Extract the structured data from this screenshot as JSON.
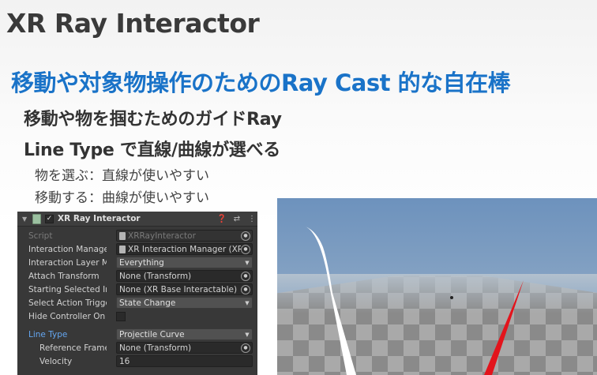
{
  "slide": {
    "title": "XR Ray Interactor",
    "heading": "移動や対象物操作のためのRay Cast 的な自在棒",
    "bullets": [
      "移動や物を掴むためのガイドRay",
      "Line Type で直線/曲線が選べる"
    ],
    "sub_bullets": [
      "物を選ぶ：直線が使いやすい",
      "移動する：曲線が使いやすい"
    ]
  },
  "inspector": {
    "title": "XR Ray Interactor",
    "enabled_mark": "✓",
    "icons": [
      "question-icon",
      "preset-icon",
      "more-icon"
    ],
    "rows": {
      "script": {
        "label": "Script",
        "value": "XRRayInteractor"
      },
      "interaction_manager": {
        "label": "Interaction Manager",
        "value": "XR Interaction Manager (XRInte"
      },
      "interaction_layer_mask": {
        "label": "Interaction Layer Mask",
        "value": "Everything"
      },
      "attach_transform": {
        "label": "Attach Transform",
        "value": "None (Transform)"
      },
      "starting_selected": {
        "label": "Starting Selected Intera",
        "value": "None (XR Base Interactable)"
      },
      "select_action_trigger": {
        "label": "Select Action Trigger",
        "value": "State Change"
      },
      "hide_controller": {
        "label": "Hide Controller On Sele",
        "value": false
      },
      "line_type": {
        "label": "Line Type",
        "value": "Projectile Curve"
      },
      "reference_frame": {
        "label": "Reference Frame",
        "value": "None (Transform)"
      },
      "velocity": {
        "label": "Velocity",
        "value": "16"
      }
    }
  },
  "scene": {
    "sky_top": "#6d92bd",
    "sky_bottom": "#9fb4c9",
    "floor_light": "#a9a9a9",
    "floor_dark": "#8a8a8a",
    "ray_white": "#ffffff",
    "ray_red": "#e3141c"
  },
  "colors": {
    "heading_blue": "#1a73c8",
    "title_gray": "#3a3a3a",
    "inspector_bg": "#383838",
    "line_type_label": "#64a6f0"
  }
}
